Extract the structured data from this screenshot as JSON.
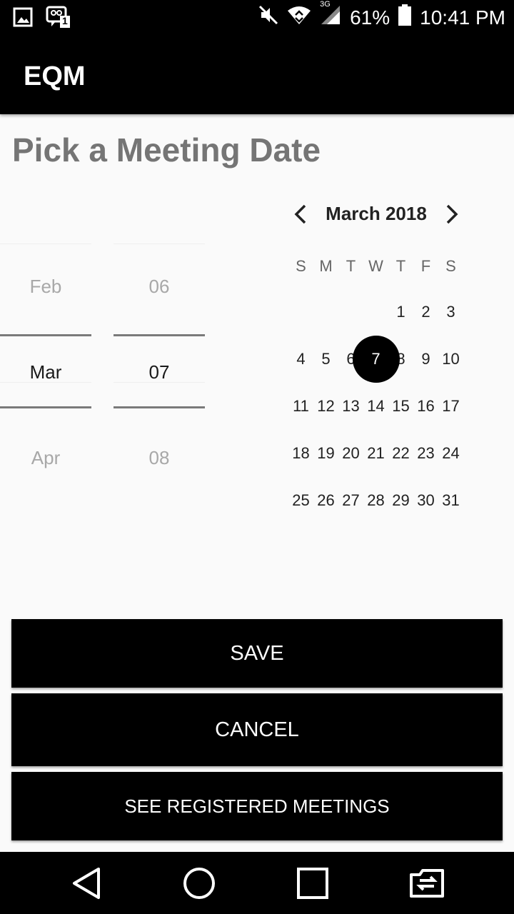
{
  "status_bar": {
    "battery": "61%",
    "time": "10:41 PM",
    "network": "3G",
    "sim_badge": "1",
    "icons": [
      "gallery-icon",
      "sim-notification-icon",
      "mute-icon",
      "wifi-icon",
      "signal-icon",
      "battery-icon"
    ]
  },
  "app": {
    "title": "EQM"
  },
  "page": {
    "title": "Pick a Meeting Date"
  },
  "spinners": {
    "month": {
      "prev": "Feb",
      "current": "Mar",
      "next": "Apr"
    },
    "day": {
      "prev": "06",
      "current": "07",
      "next": "08"
    }
  },
  "calendar": {
    "title": "March 2018",
    "weekdays": [
      "S",
      "M",
      "T",
      "W",
      "T",
      "F",
      "S"
    ],
    "selected_day": "7",
    "weeks": [
      [
        "",
        "",
        "",
        "",
        "1",
        "2",
        "3"
      ],
      [
        "4",
        "5",
        "6",
        "7",
        "8",
        "9",
        "10"
      ],
      [
        "11",
        "12",
        "13",
        "14",
        "15",
        "16",
        "17"
      ],
      [
        "18",
        "19",
        "20",
        "21",
        "22",
        "23",
        "24"
      ],
      [
        "25",
        "26",
        "27",
        "28",
        "29",
        "30",
        "31"
      ]
    ]
  },
  "buttons": {
    "save": "SAVE",
    "cancel": "CANCEL",
    "registered": "SEE REGISTERED MEETINGS"
  },
  "colors": {
    "bar": "#000000",
    "background": "#fafafa",
    "title_grey": "#757575",
    "selected": "#000000"
  }
}
